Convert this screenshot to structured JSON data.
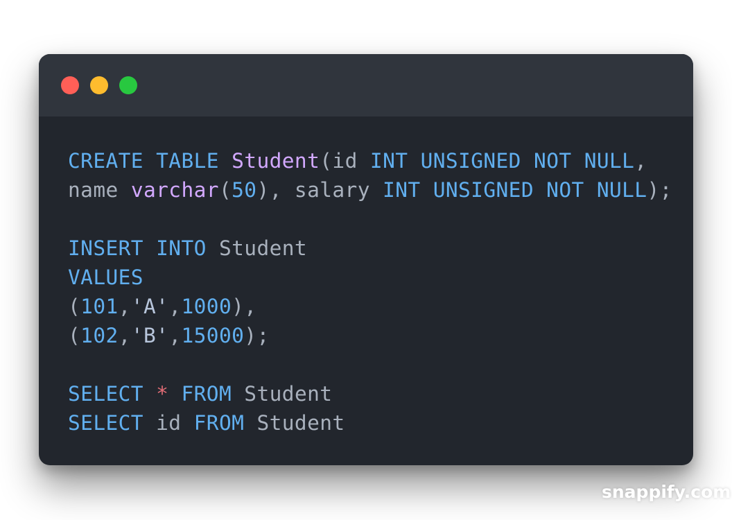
{
  "window": {
    "controls": [
      "close",
      "minimize",
      "maximize"
    ]
  },
  "code": {
    "lines": [
      [
        {
          "t": "CREATE",
          "k": "kw"
        },
        {
          "t": " ",
          "k": "tx"
        },
        {
          "t": "TABLE",
          "k": "kw"
        },
        {
          "t": " ",
          "k": "tx"
        },
        {
          "t": "Student",
          "k": "ty"
        },
        {
          "t": "(id ",
          "k": "tx"
        },
        {
          "t": "INT",
          "k": "kw"
        },
        {
          "t": " ",
          "k": "tx"
        },
        {
          "t": "UNSIGNED",
          "k": "kw"
        },
        {
          "t": " ",
          "k": "tx"
        },
        {
          "t": "NOT",
          "k": "kw"
        },
        {
          "t": " ",
          "k": "tx"
        },
        {
          "t": "NULL",
          "k": "kw"
        },
        {
          "t": ",",
          "k": "tx"
        }
      ],
      [
        {
          "t": "name ",
          "k": "tx"
        },
        {
          "t": "varchar",
          "k": "ty"
        },
        {
          "t": "(",
          "k": "tx"
        },
        {
          "t": "50",
          "k": "num"
        },
        {
          "t": "), salary ",
          "k": "tx"
        },
        {
          "t": "INT",
          "k": "kw"
        },
        {
          "t": " ",
          "k": "tx"
        },
        {
          "t": "UNSIGNED",
          "k": "kw"
        },
        {
          "t": " ",
          "k": "tx"
        },
        {
          "t": "NOT",
          "k": "kw"
        },
        {
          "t": " ",
          "k": "tx"
        },
        {
          "t": "NULL",
          "k": "kw"
        },
        {
          "t": ");",
          "k": "tx"
        }
      ],
      [],
      [
        {
          "t": "INSERT",
          "k": "kw"
        },
        {
          "t": " ",
          "k": "tx"
        },
        {
          "t": "INTO",
          "k": "kw"
        },
        {
          "t": " Student",
          "k": "tx"
        }
      ],
      [
        {
          "t": "VALUES",
          "k": "kw"
        }
      ],
      [
        {
          "t": "(",
          "k": "tx"
        },
        {
          "t": "101",
          "k": "num"
        },
        {
          "t": ",",
          "k": "tx"
        },
        {
          "t": "'A'",
          "k": "str"
        },
        {
          "t": ",",
          "k": "tx"
        },
        {
          "t": "1000",
          "k": "num"
        },
        {
          "t": "),",
          "k": "tx"
        }
      ],
      [
        {
          "t": "(",
          "k": "tx"
        },
        {
          "t": "102",
          "k": "num"
        },
        {
          "t": ",",
          "k": "tx"
        },
        {
          "t": "'B'",
          "k": "str"
        },
        {
          "t": ",",
          "k": "tx"
        },
        {
          "t": "15000",
          "k": "num"
        },
        {
          "t": ");",
          "k": "tx"
        }
      ],
      [],
      [
        {
          "t": "SELECT",
          "k": "kw"
        },
        {
          "t": " ",
          "k": "tx"
        },
        {
          "t": "*",
          "k": "op"
        },
        {
          "t": " ",
          "k": "tx"
        },
        {
          "t": "FROM",
          "k": "kw"
        },
        {
          "t": " Student",
          "k": "tx"
        }
      ],
      [
        {
          "t": "SELECT",
          "k": "kw"
        },
        {
          "t": " id ",
          "k": "tx"
        },
        {
          "t": "FROM",
          "k": "kw"
        },
        {
          "t": " Student",
          "k": "tx"
        }
      ]
    ]
  },
  "watermark": "snappify.com",
  "colors": {
    "keyword": "#61afef",
    "type": "#d2a8ff",
    "number": "#61afef",
    "string": "#b8c6dc",
    "operator": "#e06c75",
    "text": "#a9b1bd",
    "editor_bg": "#22262d",
    "titlebar_bg": "#30353d",
    "close": "#ff5f57",
    "minimize": "#febc2e",
    "maximize": "#28c840"
  }
}
